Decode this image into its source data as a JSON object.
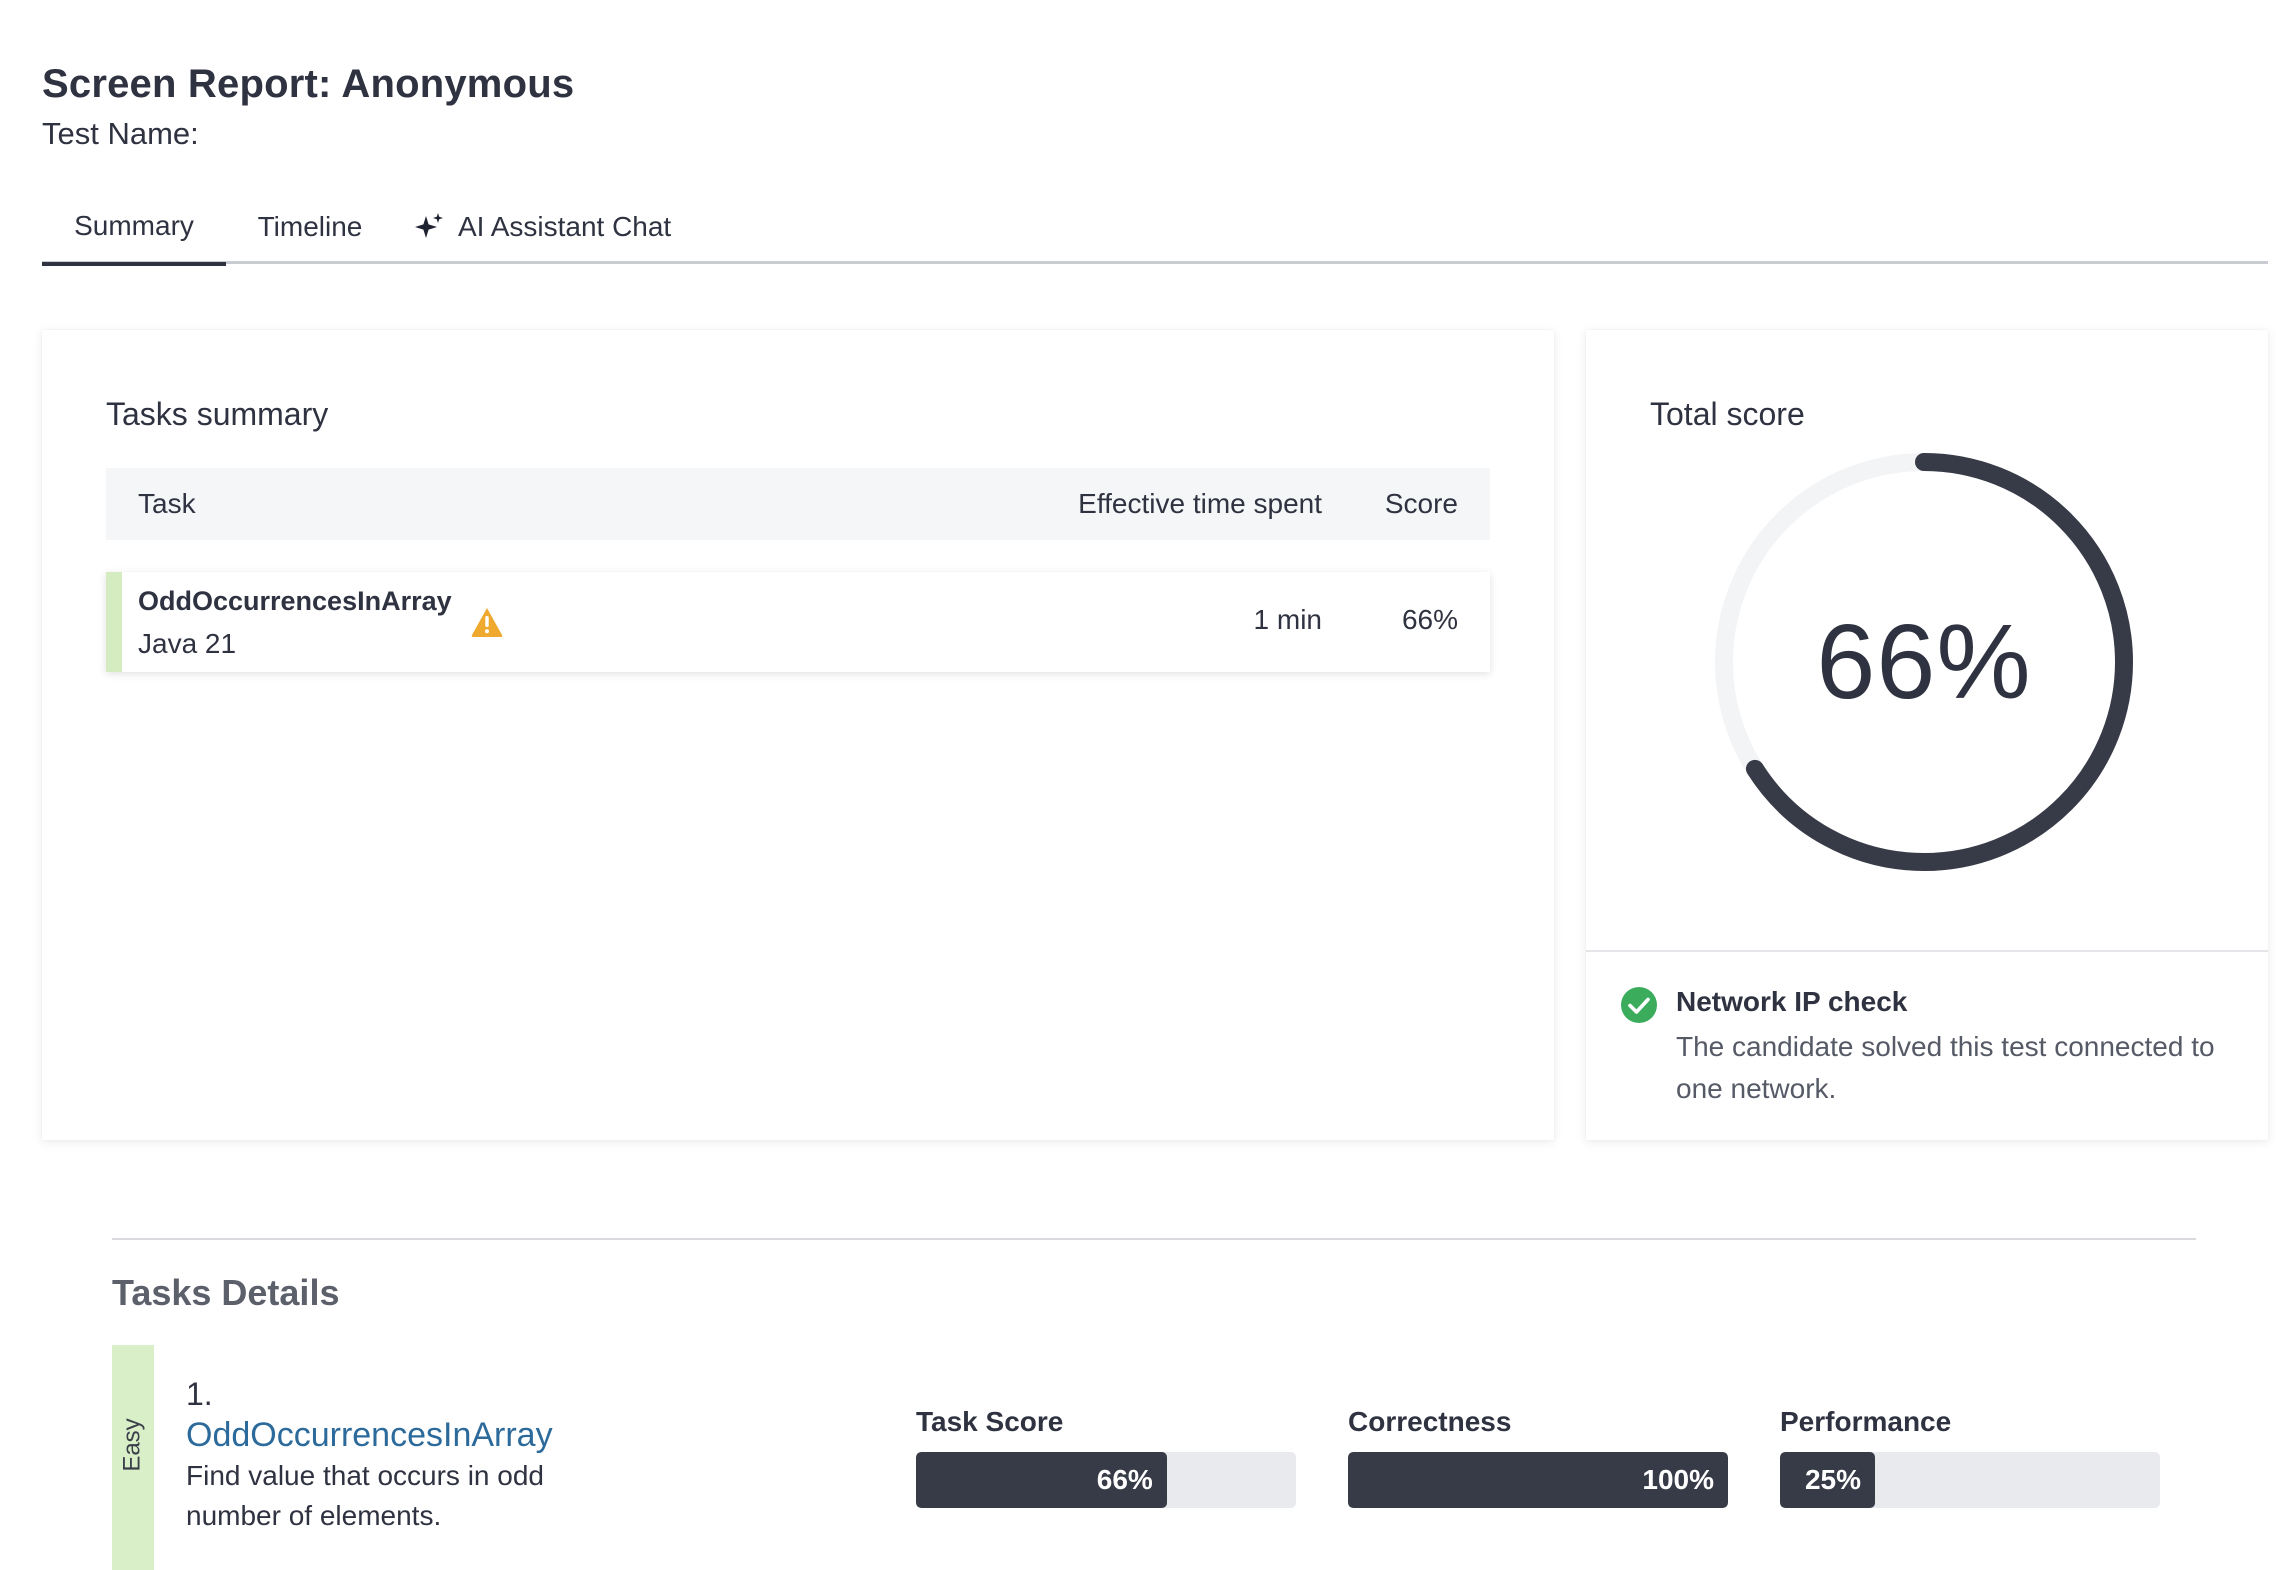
{
  "header": {
    "title": "Screen Report: Anonymous",
    "test_name_label": "Test Name:"
  },
  "tabs": [
    {
      "label": "Summary",
      "active": true
    },
    {
      "label": "Timeline",
      "active": false
    },
    {
      "label": "AI Assistant Chat",
      "active": false,
      "icon": "sparkle-icon"
    }
  ],
  "tasks_summary": {
    "title": "Tasks summary",
    "columns": [
      "Task",
      "Effective time spent",
      "Score"
    ],
    "rows": [
      {
        "name": "OddOccurrencesInArray",
        "language": "Java 21",
        "warning_icon": "warning-icon",
        "time": "1 min",
        "score": "66%",
        "accent_color": "#d4ecbf"
      }
    ]
  },
  "total_score": {
    "title": "Total score",
    "value_label": "66%",
    "fraction": 0.66,
    "network_check": {
      "icon": "check-circle-icon",
      "title": "Network IP check",
      "text": "The candidate solved this test connected to one network."
    }
  },
  "tasks_details": {
    "title": "Tasks Details",
    "items": [
      {
        "difficulty": "Easy",
        "number": "1.",
        "name": "OddOccurrencesInArray",
        "description": "Find value that occurs in odd number of elements.",
        "metrics": [
          {
            "label": "Task Score",
            "value_label": "66%",
            "fraction": 0.66
          },
          {
            "label": "Correctness",
            "value_label": "100%",
            "fraction": 1.0
          },
          {
            "label": "Performance",
            "value_label": "25%",
            "fraction": 0.25
          }
        ]
      }
    ]
  },
  "colors": {
    "primary": "#373a47",
    "link": "#2b6a9a",
    "easy": "#d9efc7",
    "warning": "#f0a92f",
    "success": "#3bab5c"
  }
}
